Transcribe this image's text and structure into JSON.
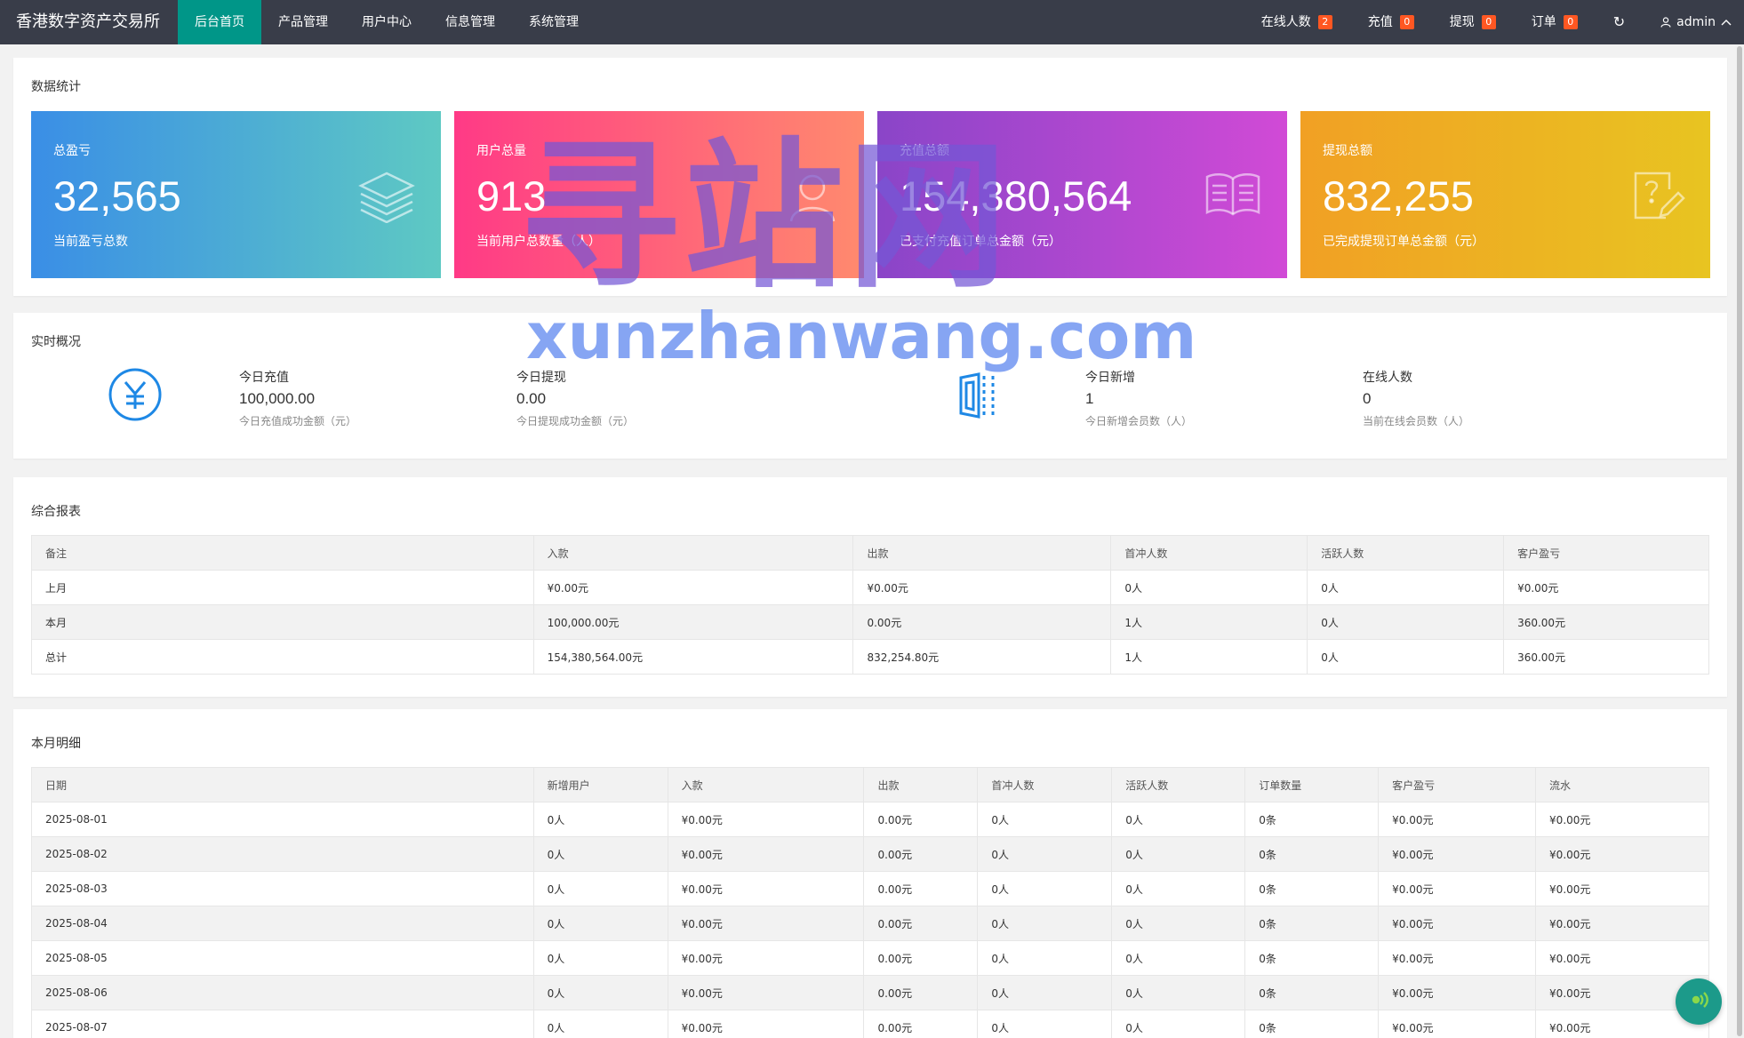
{
  "app": {
    "title": "香港数字资产交易所"
  },
  "nav": {
    "items": [
      {
        "label": "后台首页",
        "active": true
      },
      {
        "label": "产品管理",
        "active": false
      },
      {
        "label": "用户中心",
        "active": false
      },
      {
        "label": "信息管理",
        "active": false
      },
      {
        "label": "系统管理",
        "active": false
      }
    ],
    "right": {
      "online": {
        "label": "在线人数",
        "count": "2"
      },
      "recharge": {
        "label": "充值",
        "count": "0"
      },
      "withdraw": {
        "label": "提现",
        "count": "0"
      },
      "orders": {
        "label": "订单",
        "count": "0"
      },
      "refresh_icon": "refresh-icon",
      "user": "admin"
    }
  },
  "stats": {
    "title": "数据统计",
    "tiles": [
      {
        "label": "总盈亏",
        "value": "32,565",
        "desc": "当前盈亏总数",
        "icon": "layers-icon",
        "gradient": [
          "#3a8ee6",
          "#5ec9c3"
        ]
      },
      {
        "label": "用户总量",
        "value": "913",
        "desc": "当前用户总数量（人）",
        "icon": "user-icon",
        "gradient": [
          "#ff3a86",
          "#ff8a6e"
        ]
      },
      {
        "label": "充值总额",
        "value": "154,380,564",
        "desc": "已支付充值订单总金额（元）",
        "icon": "book-icon",
        "gradient": [
          "#8a45c8",
          "#d14ad6"
        ]
      },
      {
        "label": "提现总额",
        "value": "832,255",
        "desc": "已完成提现订单总金额（元）",
        "icon": "edit-icon",
        "gradient": [
          "#f1a024",
          "#e8c421"
        ]
      }
    ]
  },
  "realtime": {
    "title": "实时概况",
    "items": [
      {
        "label": "今日充值",
        "value": "100,000.00",
        "desc": "今日充值成功金额（元）"
      },
      {
        "label": "今日提现",
        "value": "0.00",
        "desc": "今日提现成功金额（元）"
      },
      {
        "label": "今日新增",
        "value": "1",
        "desc": "今日新增会员数（人）"
      },
      {
        "label": "在线人数",
        "value": "0",
        "desc": "当前在线会员数（人）"
      }
    ]
  },
  "report": {
    "title": "综合报表",
    "headers": [
      "备注",
      "入款",
      "出款",
      "首冲人数",
      "活跃人数",
      "客户盈亏"
    ],
    "rows": [
      [
        "上月",
        "¥0.00元",
        "¥0.00元",
        "0人",
        "0人",
        "¥0.00元"
      ],
      [
        "本月",
        "100,000.00元",
        "0.00元",
        "1人",
        "0人",
        "360.00元"
      ],
      [
        "总计",
        "154,380,564.00元",
        "832,254.80元",
        "1人",
        "0人",
        "360.00元"
      ]
    ]
  },
  "monthly": {
    "title": "本月明细",
    "headers": [
      "日期",
      "新增用户",
      "入款",
      "出款",
      "首冲人数",
      "活跃人数",
      "订单数量",
      "客户盈亏",
      "流水"
    ],
    "rows": [
      [
        "2025-08-01",
        "0人",
        "¥0.00元",
        "0.00元",
        "0人",
        "0人",
        "0条",
        "¥0.00元",
        "¥0.00元"
      ],
      [
        "2025-08-02",
        "0人",
        "¥0.00元",
        "0.00元",
        "0人",
        "0人",
        "0条",
        "¥0.00元",
        "¥0.00元"
      ],
      [
        "2025-08-03",
        "0人",
        "¥0.00元",
        "0.00元",
        "0人",
        "0人",
        "0条",
        "¥0.00元",
        "¥0.00元"
      ],
      [
        "2025-08-04",
        "0人",
        "¥0.00元",
        "0.00元",
        "0人",
        "0人",
        "0条",
        "¥0.00元",
        "¥0.00元"
      ],
      [
        "2025-08-05",
        "0人",
        "¥0.00元",
        "0.00元",
        "0人",
        "0人",
        "0条",
        "¥0.00元",
        "¥0.00元"
      ],
      [
        "2025-08-06",
        "0人",
        "¥0.00元",
        "0.00元",
        "0人",
        "0人",
        "0条",
        "¥0.00元",
        "¥0.00元"
      ],
      [
        "2025-08-07",
        "0人",
        "¥0.00元",
        "0.00元",
        "0人",
        "0人",
        "0条",
        "¥0.00元",
        "¥0.00元"
      ]
    ]
  },
  "watermark": {
    "cn": "寻站网",
    "en": "xunzhanwang.com"
  },
  "colors": {
    "topbar": "#393d49",
    "active": "#009688",
    "badge": "#ff5722",
    "accent_blue": "#1e9fff"
  }
}
